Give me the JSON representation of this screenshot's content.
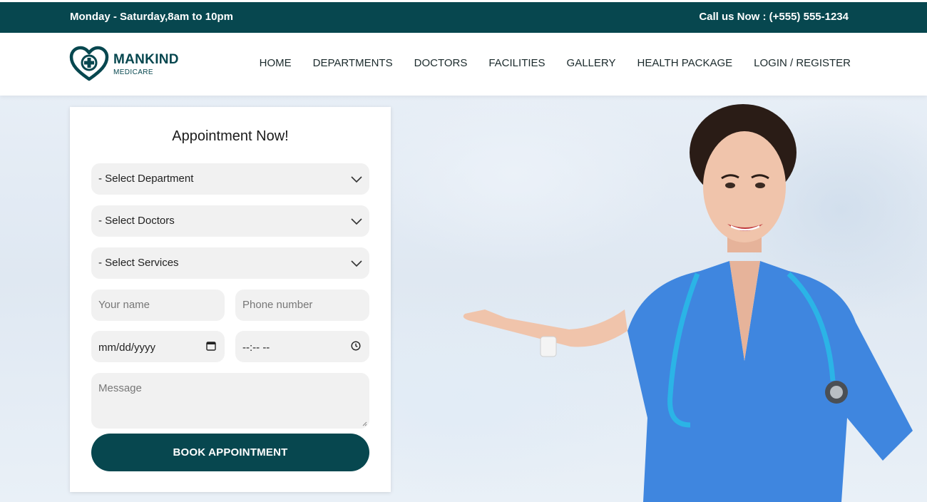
{
  "topbar": {
    "hours": "Monday - Saturday,8am to 10pm",
    "call": "Call us Now : (+555) 555-1234",
    "bg_color": "#07474f"
  },
  "brand": {
    "name": "MANKIND",
    "tagline": "MEDICARE",
    "logo_icon": "heart-cross-icon"
  },
  "nav": {
    "items": [
      "HOME",
      "DEPARTMENTS",
      "DOCTORS",
      "FACILITIES",
      "GALLERY",
      "HEALTH PACKAGE",
      "LOGIN / REGISTER"
    ]
  },
  "form": {
    "title": "Appointment Now!",
    "department": "- Select Department",
    "doctors": "- Select Doctors",
    "services": "- Select Services",
    "name_placeholder": "Your name",
    "phone_placeholder": "Phone number",
    "date_placeholder": "mm/dd/yyyy",
    "time_placeholder": "--:-- --",
    "message_placeholder": "Message",
    "submit": "BOOK APPOINTMENT"
  },
  "colors": {
    "primary": "#07474f",
    "field_bg": "#f1f1f1",
    "scrub": "#3f86df",
    "stethoscope": "#2bb4e6"
  }
}
